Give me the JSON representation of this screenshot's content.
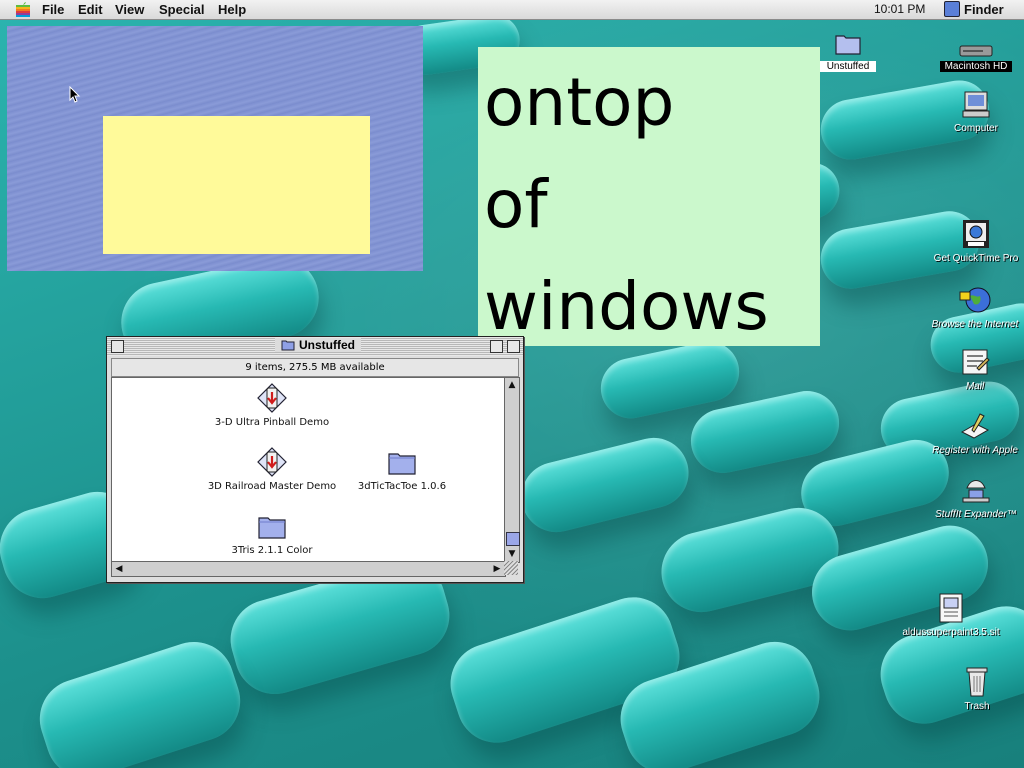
{
  "menubar": {
    "items": [
      "File",
      "Edit",
      "View",
      "Special",
      "Help"
    ],
    "clock": "10:01 PM",
    "app": "Finder"
  },
  "overlay_text": [
    "ontop",
    "of",
    "windows"
  ],
  "window": {
    "title": "Unstuffed",
    "info": "9 items, 275.5 MB available",
    "items": [
      {
        "label": "3-D Ultra Pinball Demo",
        "icon": "installer-icon"
      },
      {
        "label": "3D Railroad Master Demo",
        "icon": "installer-icon"
      },
      {
        "label": "3dTicTacToe 1.0.6",
        "icon": "folder-icon"
      },
      {
        "label": "3Tris 2.1.1 Color",
        "icon": "folder-icon"
      }
    ]
  },
  "desktop_icons": [
    {
      "label": "Unstuffed",
      "icon": "folder-icon"
    },
    {
      "label": "Macintosh HD",
      "icon": "hard-drive-icon"
    },
    {
      "label": "Computer",
      "icon": "computer-icon"
    },
    {
      "label": "Get QuickTime Pro",
      "icon": "quicktime-icon"
    },
    {
      "label": "Browse the Internet",
      "icon": "globe-icon"
    },
    {
      "label": "Mail",
      "icon": "mail-icon"
    },
    {
      "label": "Register with Apple",
      "icon": "register-icon"
    },
    {
      "label": "StuffIt Expander™",
      "icon": "stuffit-icon"
    },
    {
      "label": "aldussuperpaint3.5.sit",
      "icon": "archive-icon"
    },
    {
      "label": "Trash",
      "icon": "trash-icon"
    }
  ]
}
